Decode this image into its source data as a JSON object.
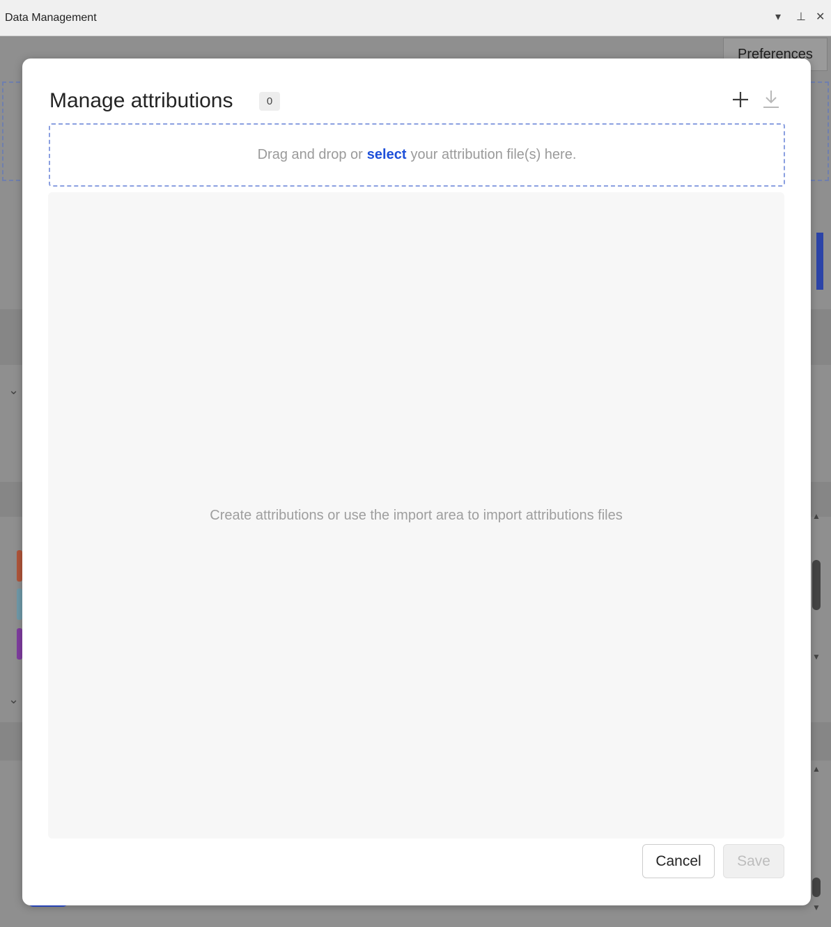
{
  "window": {
    "title": "Data Management",
    "controls": {
      "dropdown": "▾",
      "pin": "⊥",
      "close": "✕"
    }
  },
  "background": {
    "tab_label": "Preferences"
  },
  "dialog": {
    "title": "Manage attributions",
    "count": "0",
    "add_icon": "plus-icon",
    "download_icon": "download-icon",
    "dropzone": {
      "before": "Drag and drop or",
      "link": "select",
      "after": "your attribution file(s) here.",
      "link_color": "#1d4fd9",
      "border_color": "#8a9fe0"
    },
    "empty_message": "Create attributions or use the import area to import attributions files",
    "buttons": {
      "cancel": "Cancel",
      "save": "Save",
      "save_enabled": false
    }
  }
}
